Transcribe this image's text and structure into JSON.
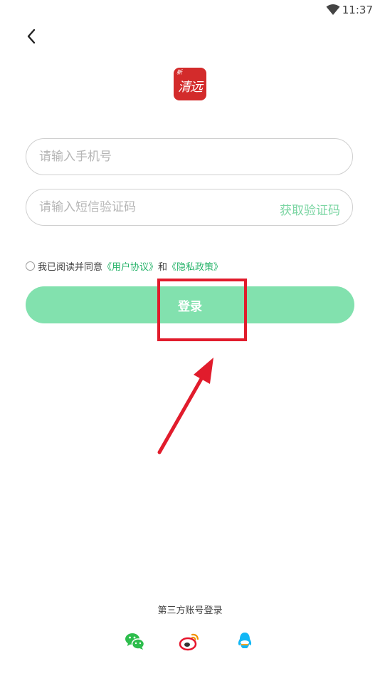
{
  "status_bar": {
    "time": "11:37"
  },
  "form": {
    "phone_placeholder": "请输入手机号",
    "code_placeholder": "请输入短信验证码",
    "get_code_label": "获取验证码"
  },
  "agreement": {
    "prefix": "我已阅读并同意",
    "user_agreement": "《用户协议》",
    "joiner": "和",
    "privacy_policy": "《隐私政策》"
  },
  "login_button_label": "登录",
  "third_party": {
    "title": "第三方账号登录",
    "icons": [
      "wechat-icon",
      "weibo-icon",
      "qq-icon"
    ]
  },
  "colors": {
    "accent": "#82e1ae",
    "link": "#27b36a",
    "get_code": "#7dd6a4",
    "logo_red": "#d32b2b",
    "annotation_red": "#e11c2c"
  }
}
